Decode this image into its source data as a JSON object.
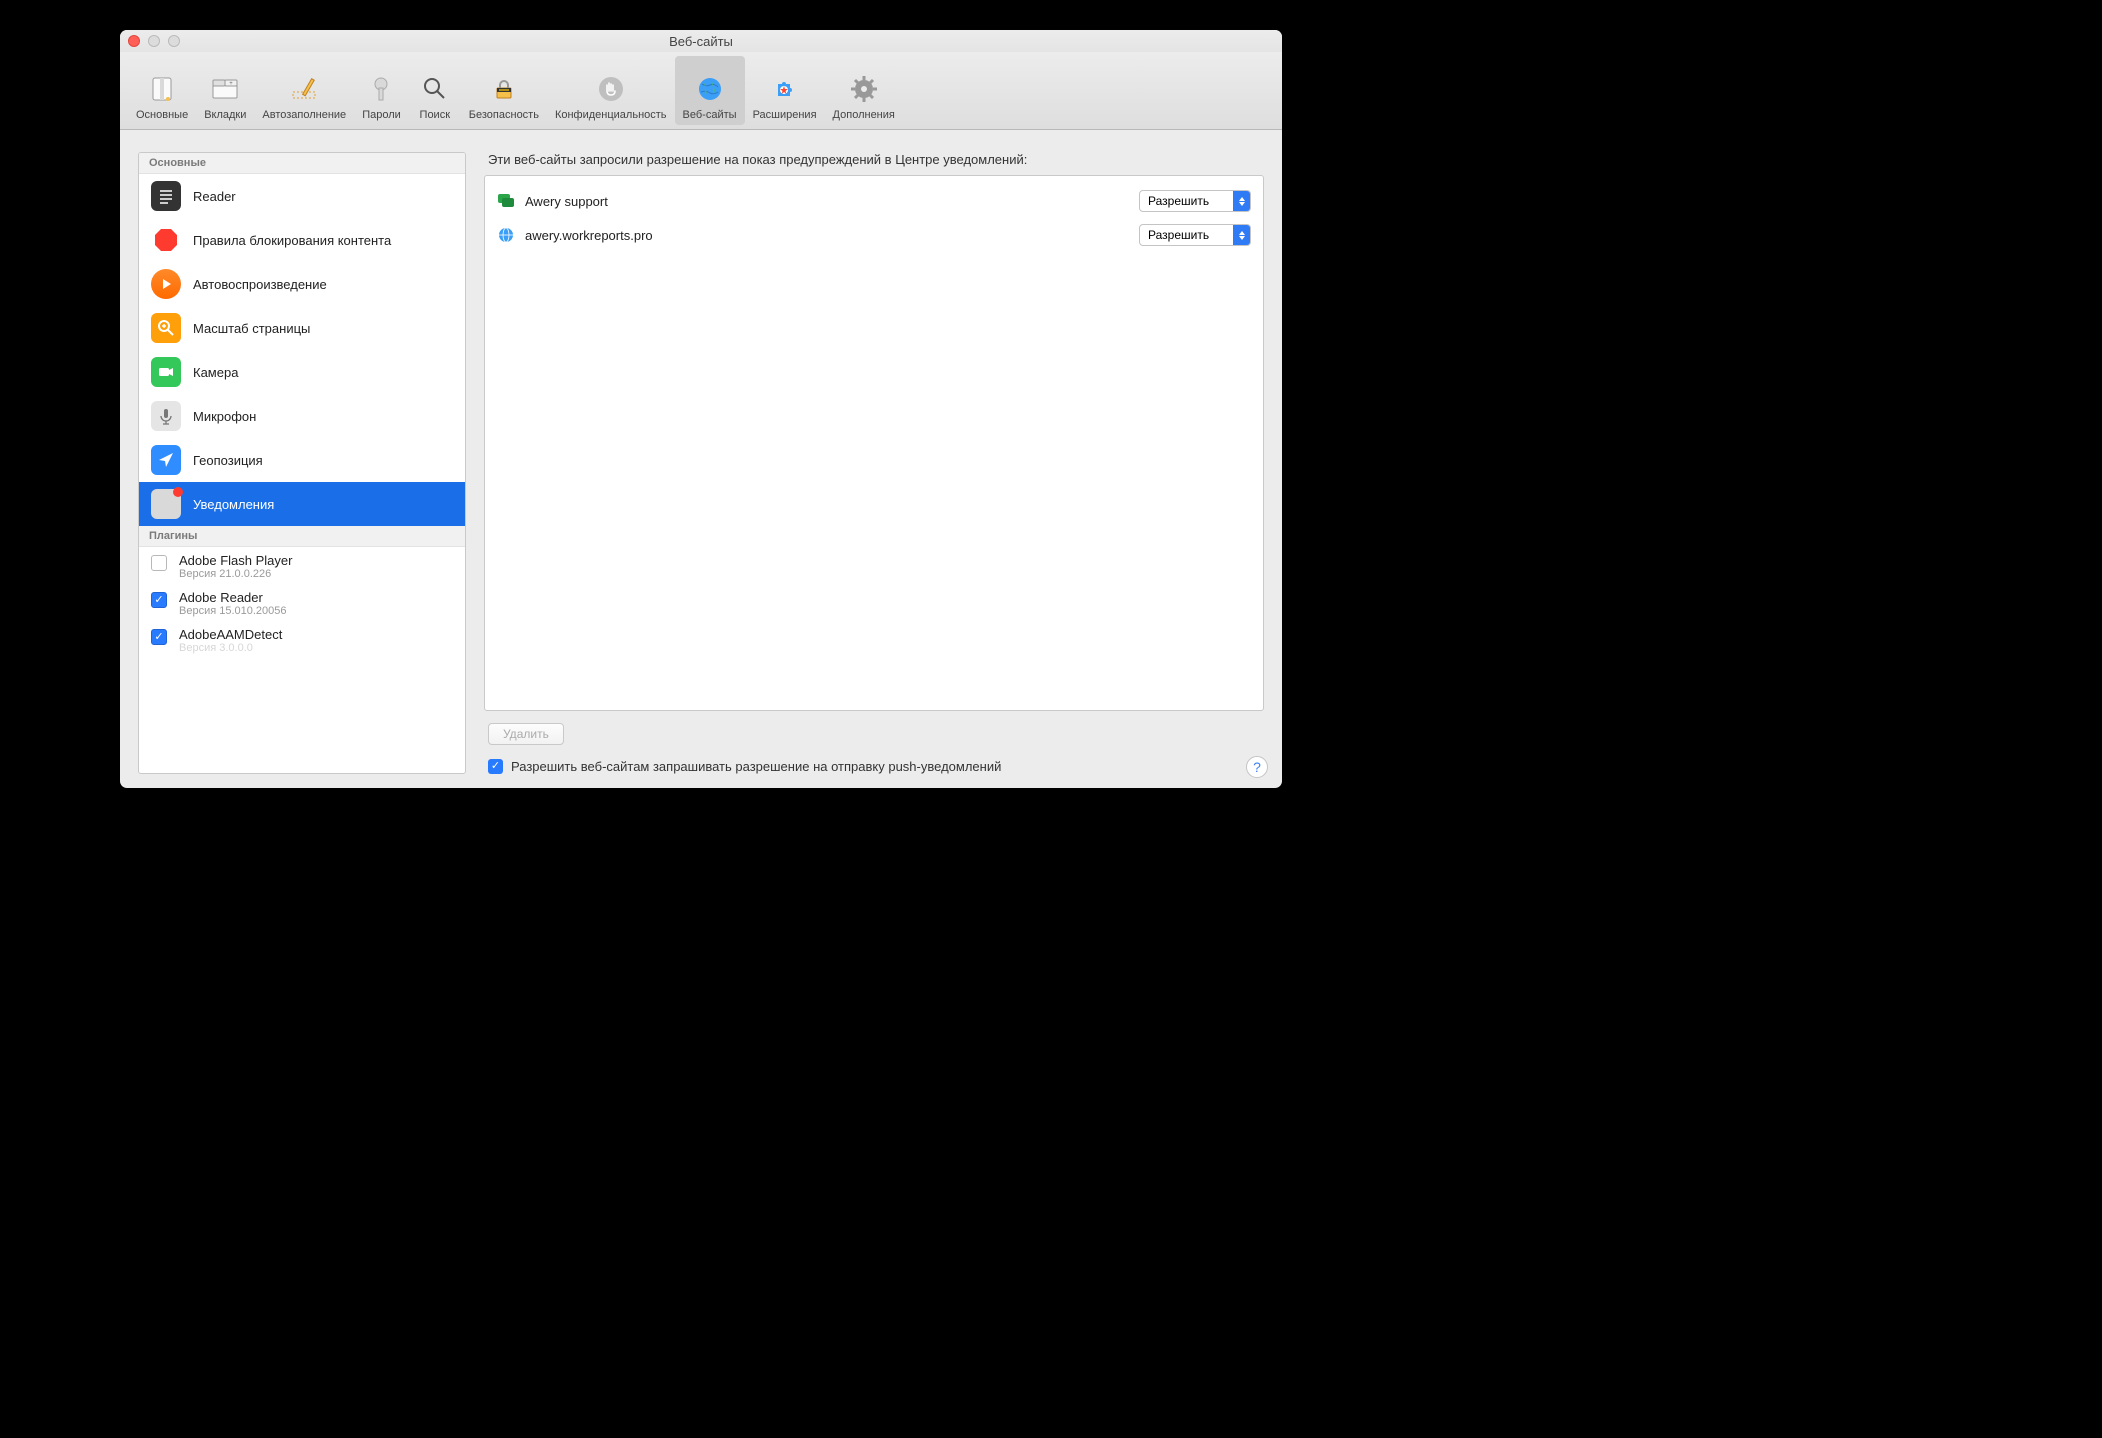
{
  "window": {
    "title": "Веб-сайты"
  },
  "toolbar": [
    {
      "id": "general",
      "label": "Основные",
      "selected": false
    },
    {
      "id": "tabs",
      "label": "Вкладки",
      "selected": false
    },
    {
      "id": "autofill",
      "label": "Автозаполнение",
      "selected": false
    },
    {
      "id": "passwords",
      "label": "Пароли",
      "selected": false
    },
    {
      "id": "search",
      "label": "Поиск",
      "selected": false
    },
    {
      "id": "security",
      "label": "Безопасность",
      "selected": false
    },
    {
      "id": "privacy",
      "label": "Конфиденциальность",
      "selected": false
    },
    {
      "id": "websites",
      "label": "Веб-сайты",
      "selected": true
    },
    {
      "id": "extensions",
      "label": "Расширения",
      "selected": false
    },
    {
      "id": "advanced",
      "label": "Дополнения",
      "selected": false
    }
  ],
  "sidebar": {
    "section1_title": "Основные",
    "items": [
      {
        "id": "reader",
        "label": "Reader"
      },
      {
        "id": "contentblock",
        "label": "Правила блокирования контента"
      },
      {
        "id": "autoplay",
        "label": "Автовоспроизведение"
      },
      {
        "id": "zoom",
        "label": "Масштаб страницы"
      },
      {
        "id": "camera",
        "label": "Камера"
      },
      {
        "id": "microphone",
        "label": "Микрофон"
      },
      {
        "id": "location",
        "label": "Геопозиция"
      },
      {
        "id": "notifications",
        "label": "Уведомления",
        "selected": true
      }
    ],
    "section2_title": "Плагины",
    "plugins": [
      {
        "name": "Adobe Flash Player",
        "version": "Версия 21.0.0.226",
        "checked": false
      },
      {
        "name": "Adobe Reader",
        "version": "Версия 15.010.20056",
        "checked": true
      },
      {
        "name": "AdobeAAMDetect",
        "version": "Версия 3.0.0.0",
        "checked": true
      }
    ]
  },
  "main": {
    "description": "Эти веб-сайты запросили разрешение на показ предупреждений в Центре уведомлений:",
    "sites": [
      {
        "icon": "chat",
        "name": "Awery support",
        "permission": "Разрешить"
      },
      {
        "icon": "globe",
        "name": "awery.workreports.pro",
        "permission": "Разрешить"
      }
    ],
    "delete_label": "Удалить",
    "allow_push_checked": true,
    "allow_push_label": "Разрешить веб-сайтам запрашивать разрешение на отправку push-уведомлений"
  }
}
